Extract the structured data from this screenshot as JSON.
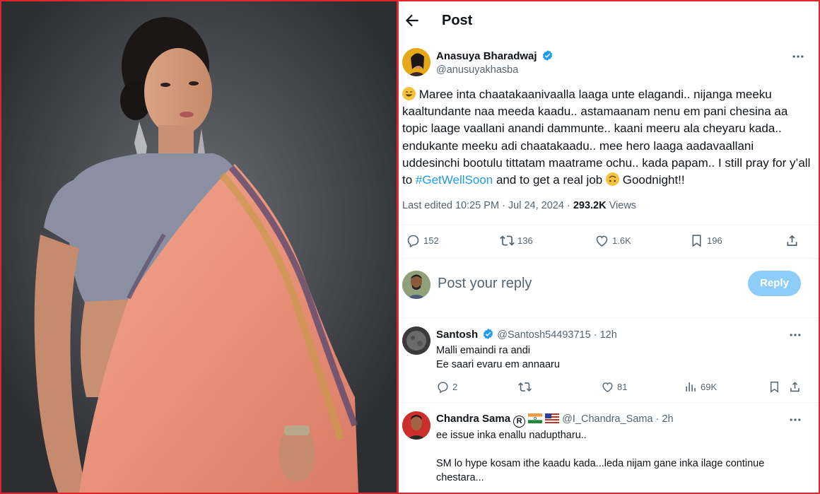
{
  "header": {
    "title": "Post"
  },
  "post": {
    "author_name": "Anasuya Bharadwaj",
    "author_handle": "@anusuyakhasba",
    "text_part1": "Maree inta chaatakaanivaalla laaga unte elagandi.. nijanga meeku kaaltundante naa meeda kaadu.. astamaanam nenu em pani chesina aa topic laage vaallani anandi dammunte.. kaani meeru ala cheyaru kada.. endukante meeku adi chaatakaadu.. mee hero laaga aadavaallani uddesinchi bootulu tittatam maatrame ochu.. kada papam.. I still pray for y’all to",
    "hashtag": "#GetWellSoon",
    "text_part2": "and to get a real job",
    "text_part3": "Goodnight!!",
    "edited_time": "Last edited 10:25 PM · Jul 24, 2024 ·",
    "views_count": "293.2K",
    "views_label": "Views",
    "stats": {
      "replies": "152",
      "reposts": "136",
      "likes": "1.6K",
      "bookmarks": "196"
    }
  },
  "reply_composer": {
    "placeholder": "Post your reply",
    "button_label": "Reply"
  },
  "comments": [
    {
      "name": "Santosh",
      "handle": "@Santosh54493715",
      "time": "· 12h",
      "lines": [
        "Malli emaindi ra andi",
        "Ee saari evaru em annaaru"
      ],
      "stats": {
        "replies": "2",
        "reposts": "",
        "likes": "81",
        "views": "69K"
      }
    },
    {
      "name": "Chandra Sama",
      "handle": "@I_Chandra_Sama",
      "time": "· 2h",
      "lines": [
        "ee issue inka enallu naduptharu..",
        "SM lo hype kosam ithe kaadu kada...leda nijam gane inka ilage continue chestara..."
      ]
    }
  ],
  "colors": {
    "accent": "#1d9bf0",
    "reply_button": "#8ecdf7",
    "frame": "#e0262b",
    "secondary_text": "#536471"
  }
}
